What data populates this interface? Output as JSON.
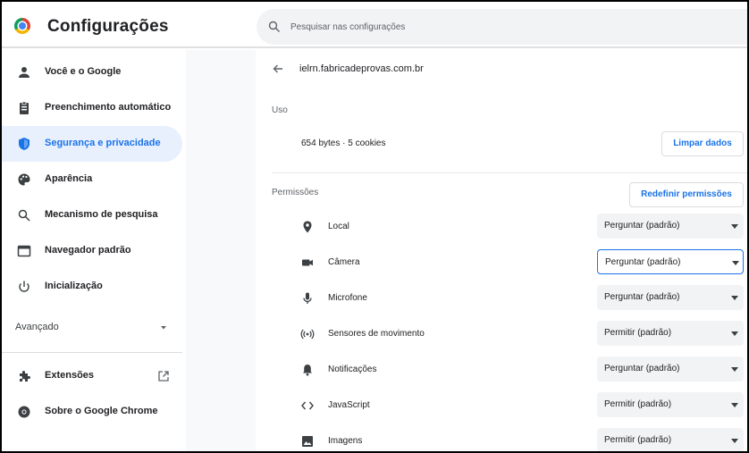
{
  "header": {
    "title": "Configurações",
    "search_placeholder": "Pesquisar nas configurações"
  },
  "sidebar": {
    "items": [
      {
        "label": "Você e o Google",
        "icon": "person-icon"
      },
      {
        "label": "Preenchimento automático",
        "icon": "clipboard-icon"
      },
      {
        "label": "Segurança e privacidade",
        "icon": "shield-icon",
        "active": true
      },
      {
        "label": "Aparência",
        "icon": "palette-icon"
      },
      {
        "label": "Mecanismo de pesquisa",
        "icon": "search-icon"
      },
      {
        "label": "Navegador padrão",
        "icon": "browser-icon"
      },
      {
        "label": "Inicialização",
        "icon": "power-icon"
      }
    ],
    "advanced_label": "Avançado",
    "extensions_label": "Extensões",
    "about_label": "Sobre o Google Chrome"
  },
  "site": {
    "title": "ielrn.fabricadeprovas.com.br"
  },
  "usage": {
    "heading": "Uso",
    "text": "654 bytes · 5 cookies",
    "clear_button": "Limpar dados"
  },
  "permissions": {
    "heading": "Permissões",
    "reset_button": "Redefinir permissões",
    "rows": [
      {
        "label": "Local",
        "icon": "location-pin-icon",
        "value": "Perguntar (padrão)"
      },
      {
        "label": "Câmera",
        "icon": "camera-icon",
        "value": "Perguntar (padrão)",
        "focused": true
      },
      {
        "label": "Microfone",
        "icon": "microphone-icon",
        "value": "Perguntar (padrão)"
      },
      {
        "label": "Sensores de movimento",
        "icon": "motion-sensor-icon",
        "value": "Permitir (padrão)"
      },
      {
        "label": "Notificações",
        "icon": "bell-icon",
        "value": "Perguntar (padrão)"
      },
      {
        "label": "JavaScript",
        "icon": "code-icon",
        "value": "Permitir (padrão)"
      },
      {
        "label": "Imagens",
        "icon": "image-icon",
        "value": "Permitir (padrão)"
      }
    ]
  },
  "colors": {
    "accent": "#1a73e8",
    "active_bg": "#e8f0fe",
    "select_bg": "#f1f3f4"
  }
}
